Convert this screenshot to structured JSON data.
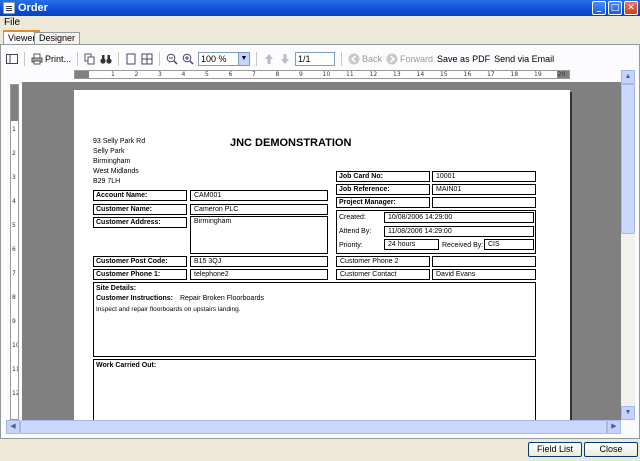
{
  "window": {
    "title": "Order"
  },
  "menu": {
    "file": "File"
  },
  "tabs": {
    "viewer": "Viewer",
    "designer": "Designer"
  },
  "toolbar": {
    "print": "Print...",
    "zoom": "100 %",
    "page": "1/1",
    "back": "Back",
    "forward": "Forward",
    "save_pdf": "Save as PDF",
    "send_email": "Send via Email"
  },
  "ruler": {
    "h_labels": [
      "1",
      "2",
      "3",
      "4",
      "5",
      "6",
      "7",
      "8",
      "9",
      "10",
      "11",
      "12",
      "13",
      "14",
      "15",
      "16",
      "17",
      "18",
      "19",
      "20"
    ],
    "v_labels": [
      "1",
      "2",
      "3",
      "4",
      "5",
      "6",
      "7",
      "8",
      "9",
      "10",
      "11",
      "12"
    ]
  },
  "report": {
    "address": [
      "93 Selly Park Rd",
      "Selly Park",
      "Birmingham",
      "West Midlands",
      "B29 7LH"
    ],
    "title": "JNC  DEMONSTRATION",
    "account_name_label": "Account Name:",
    "account_name": "CAM001",
    "customer_name_label": "Customer Name:",
    "customer_name": "Cameron PLC",
    "customer_address_label": "Customer Address:",
    "customer_address": "Birmingham",
    "post_code_label": "Customer Post Code:",
    "post_code": "B15 3QJ",
    "phone1_label": "Customer Phone 1:",
    "phone1": "telephone2",
    "job_card_label": "Job Card No:",
    "job_card": "10001",
    "job_ref_label": "Job Reference:",
    "job_ref": "MAIN01",
    "pm_label": "Project Manager:",
    "pm": "",
    "created_label": "Created:",
    "created": "10/08/2006 14:29:00",
    "attend_label": "Attend By:",
    "attend": "11/08/2006 14:29:00",
    "priority_label": "Priority:",
    "priority": "24 hours",
    "received_label": "Received By:",
    "received": "CIS",
    "phone2_label": "Customer Phone 2",
    "phone2": "",
    "contact_label": "Customer Contact",
    "contact": "David Evans",
    "site_details_label": "Site Details:",
    "instructions_label": "Customer Instructions:",
    "instructions": "Repair Broken Floorboards",
    "instructions_detail": "Inspect and repair floorboards on upstairs landing.",
    "work_label": "Work Carried Out:"
  },
  "buttons": {
    "field_list": "Field List",
    "close": "Close"
  }
}
